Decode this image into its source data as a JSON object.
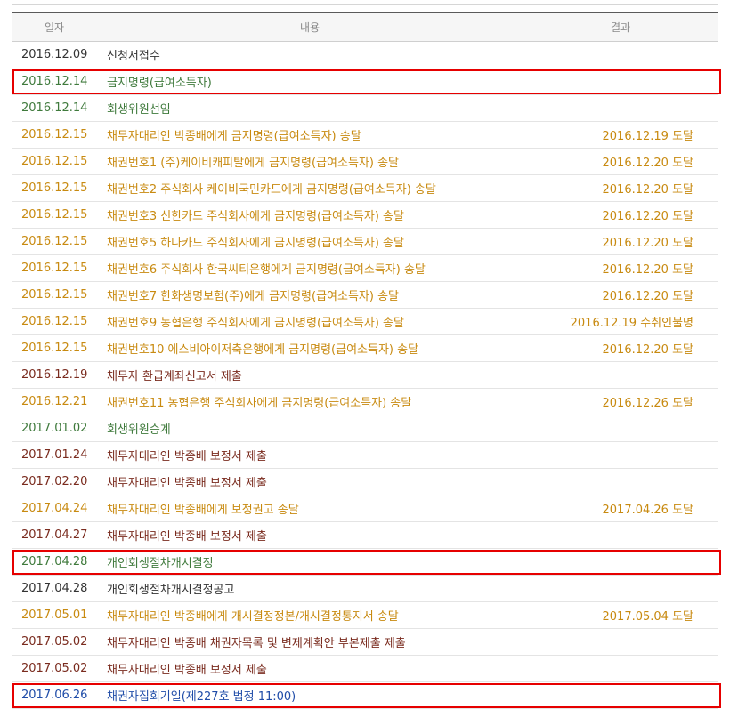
{
  "header": {
    "date": "일자",
    "content": "내용",
    "result": "결과"
  },
  "rows": [
    {
      "date": "2016.12.09",
      "content": "신청서접수",
      "result": "",
      "color": "black"
    },
    {
      "date": "2016.12.14",
      "content": "금지명령(급여소득자)",
      "result": "",
      "color": "green"
    },
    {
      "date": "2016.12.14",
      "content": "회생위원선임",
      "result": "",
      "color": "green"
    },
    {
      "date": "2016.12.15",
      "content": "채무자대리인 박종배에게 금지명령(급여소득자) 송달",
      "result": "2016.12.19 도달",
      "color": "orange"
    },
    {
      "date": "2016.12.15",
      "content": "채권번호1 (주)케이비캐피탈에게 금지명령(급여소득자) 송달",
      "result": "2016.12.20 도달",
      "color": "orange"
    },
    {
      "date": "2016.12.15",
      "content": "채권번호2 주식회사 케이비국민카드에게 금지명령(급여소득자) 송달",
      "result": "2016.12.20 도달",
      "color": "orange"
    },
    {
      "date": "2016.12.15",
      "content": "채권번호3 신한카드 주식회사에게 금지명령(급여소득자) 송달",
      "result": "2016.12.20 도달",
      "color": "orange"
    },
    {
      "date": "2016.12.15",
      "content": "채권번호5 하나카드 주식회사에게 금지명령(급여소득자) 송달",
      "result": "2016.12.20 도달",
      "color": "orange"
    },
    {
      "date": "2016.12.15",
      "content": "채권번호6 주식회사 한국씨티은행에게 금지명령(급여소득자) 송달",
      "result": "2016.12.20 도달",
      "color": "orange"
    },
    {
      "date": "2016.12.15",
      "content": "채권번호7 한화생명보험(주)에게 금지명령(급여소득자) 송달",
      "result": "2016.12.20 도달",
      "color": "orange"
    },
    {
      "date": "2016.12.15",
      "content": "채권번호9 농협은행 주식회사에게 금지명령(급여소득자) 송달",
      "result": "2016.12.19 수취인불명",
      "color": "orange"
    },
    {
      "date": "2016.12.15",
      "content": "채권번호10 에스비아이저축은행에게 금지명령(급여소득자) 송달",
      "result": "2016.12.20 도달",
      "color": "orange"
    },
    {
      "date": "2016.12.19",
      "content": "채무자          환급계좌신고서 제출",
      "result": "",
      "color": "brown"
    },
    {
      "date": "2016.12.21",
      "content": "채권번호11 농협은행 주식회사에게 금지명령(급여소득자) 송달",
      "result": "2016.12.26 도달",
      "color": "orange"
    },
    {
      "date": "2017.01.02",
      "content": "회생위원승계",
      "result": "",
      "color": "green"
    },
    {
      "date": "2017.01.24",
      "content": "채무자대리인 박종배 보정서 제출",
      "result": "",
      "color": "brown"
    },
    {
      "date": "2017.02.20",
      "content": "채무자대리인 박종배 보정서 제출",
      "result": "",
      "color": "brown"
    },
    {
      "date": "2017.04.24",
      "content": "채무자대리인 박종배에게 보정권고 송달",
      "result": "2017.04.26 도달",
      "color": "orange"
    },
    {
      "date": "2017.04.27",
      "content": "채무자대리인 박종배 보정서 제출",
      "result": "",
      "color": "brown"
    },
    {
      "date": "2017.04.28",
      "content": "개인회생절차개시결정",
      "result": "",
      "color": "green"
    },
    {
      "date": "2017.04.28",
      "content": "개인회생절차개시결정공고",
      "result": "",
      "color": "black"
    },
    {
      "date": "2017.05.01",
      "content": "채무자대리인 박종배에게 개시결정정본/개시결정통지서 송달",
      "result": "2017.05.04 도달",
      "color": "orange"
    },
    {
      "date": "2017.05.02",
      "content": "채무자대리인 박종배 채권자목록 및 변제계획안 부본제출 제출",
      "result": "",
      "color": "brown"
    },
    {
      "date": "2017.05.02",
      "content": "채무자대리인 박종배 보정서 제출",
      "result": "",
      "color": "brown"
    },
    {
      "date": "2017.06.26",
      "content": "채권자집회기일(제227호 법정 11:00)",
      "result": "",
      "color": "blue"
    }
  ],
  "highlighted_rows": [
    1,
    19,
    24
  ],
  "colors": {
    "black": "#333333",
    "green": "#3f7a3c",
    "orange": "#c88a10",
    "brown": "#7a2b1e",
    "blue": "#1f4ca8",
    "highlight": "#e60000"
  }
}
